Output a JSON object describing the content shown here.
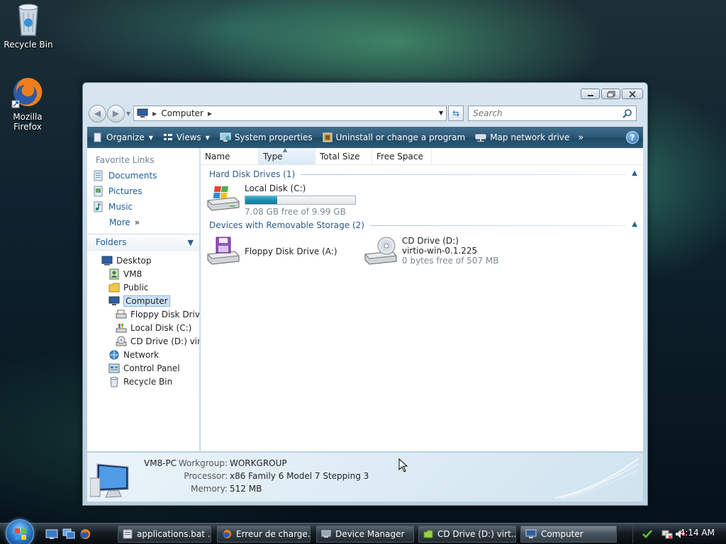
{
  "desktop": {
    "icons": [
      {
        "label": "Recycle Bin",
        "icon": "recycle-bin-icon"
      },
      {
        "label": "Mozilla Firefox",
        "icon": "firefox-icon"
      }
    ]
  },
  "window": {
    "address": {
      "crumb": "Computer"
    },
    "search": {
      "placeholder": "Search"
    },
    "toolbar": {
      "organize": "Organize",
      "views": "Views",
      "system_properties": "System properties",
      "uninstall": "Uninstall or change a program",
      "map_drive": "Map network drive",
      "overflow": "»"
    },
    "favorites": {
      "title": "Favorite Links",
      "items": [
        {
          "label": "Documents",
          "icon": "documents-icon"
        },
        {
          "label": "Pictures",
          "icon": "pictures-icon"
        },
        {
          "label": "Music",
          "icon": "music-icon"
        }
      ],
      "more": "More"
    },
    "folders": {
      "title": "Folders",
      "tree": [
        {
          "label": "Desktop",
          "icon": "desktop-icon",
          "level": 0
        },
        {
          "label": "VM8",
          "icon": "user-folder-icon",
          "level": 1
        },
        {
          "label": "Public",
          "icon": "folder-icon",
          "level": 1
        },
        {
          "label": "Computer",
          "icon": "computer-icon",
          "level": 1,
          "selected": true
        },
        {
          "label": "Floppy Disk Drive",
          "icon": "floppy-drive-icon",
          "level": 2
        },
        {
          "label": "Local Disk (C:)",
          "icon": "local-disk-icon",
          "level": 2
        },
        {
          "label": "CD Drive (D:) virtio",
          "icon": "cd-drive-icon",
          "level": 2
        },
        {
          "label": "Network",
          "icon": "network-icon",
          "level": 1
        },
        {
          "label": "Control Panel",
          "icon": "control-panel-icon",
          "level": 1
        },
        {
          "label": "Recycle Bin",
          "icon": "recycle-bin-icon",
          "level": 1
        }
      ]
    },
    "columns": [
      "Name",
      "Type",
      "Total Size",
      "Free Space"
    ],
    "groups": {
      "hard_disks": {
        "title": "Hard Disk Drives (1)",
        "drives": [
          {
            "name": "Local Disk (C:)",
            "free": "7.08 GB free of 9.99 GB",
            "used_fraction": 0.29
          }
        ]
      },
      "removable": {
        "title": "Devices with Removable Storage (2)",
        "drives": [
          {
            "name": "Floppy Disk Drive (A:)"
          },
          {
            "name": "CD Drive (D:)",
            "sub": "virtio-win-0.1.225",
            "free": "0 bytes free of 507 MB"
          }
        ]
      }
    },
    "details": {
      "computer_name": "VM8-PC",
      "workgroup_label": "Workgroup:",
      "workgroup": "WORKGROUP",
      "processor_label": "Processor:",
      "processor": "x86 Family 6 Model 7 Stepping 3",
      "memory_label": "Memory:",
      "memory": "512 MB"
    }
  },
  "taskbar": {
    "buttons": [
      {
        "label": "applications.bat ...",
        "icon": "batch-file-icon"
      },
      {
        "label": "Erreur de charge...",
        "icon": "firefox-icon"
      },
      {
        "label": "Device Manager",
        "icon": "device-manager-icon"
      },
      {
        "label": "CD Drive (D:) virt...",
        "icon": "folder-icon"
      },
      {
        "label": "Computer",
        "icon": "computer-icon"
      }
    ],
    "clock": "4:14 AM"
  }
}
